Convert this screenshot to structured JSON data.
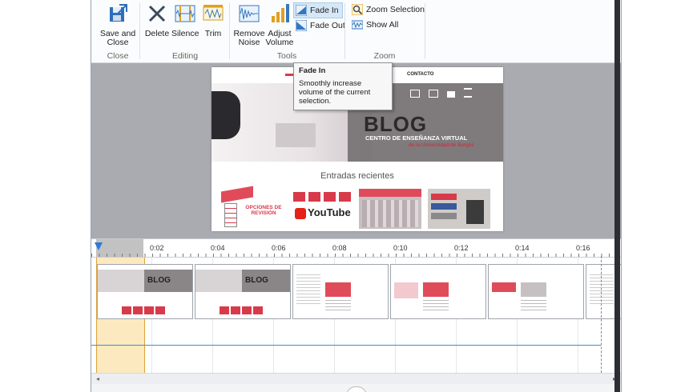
{
  "ribbon": {
    "groups": {
      "close": {
        "label": "Close",
        "save_close": "Save and\nClose"
      },
      "editing": {
        "label": "Editing",
        "delete": "Delete",
        "silence": "Silence",
        "trim": "Trim"
      },
      "tools": {
        "label": "Tools",
        "remove_noise": "Remove\nNoise",
        "adjust_volume": "Adjust\nVolume",
        "fade_in": "Fade In",
        "fade_out": "Fade Out"
      },
      "zoom": {
        "label": "Zoom",
        "zoom_selection": "Zoom Selection",
        "show_all": "Show All"
      }
    }
  },
  "tooltip": {
    "title": "Fade In",
    "body": "Smoothly increase volume of the current selection."
  },
  "preview": {
    "nav_contact": "CONTACTO",
    "blog_title": "BLOG",
    "blog_subtitle": "CENTRO DE ENSEÑANZA VIRTUAL",
    "blog_subtitle2": "de la Universidad de Burgos",
    "recent": "Entradas recientes",
    "card1": "OPCIONES DE REVISIÓN",
    "card2": "YouTube"
  },
  "timeline": {
    "ticks": [
      "0:02",
      "0:04",
      "0:06",
      "0:08",
      "0:10",
      "0:12",
      "0:14",
      "0:16"
    ]
  },
  "colors": {
    "selection": "#fad78c",
    "accent": "#d83a4a",
    "fade_selected": "#d6e8f7"
  }
}
